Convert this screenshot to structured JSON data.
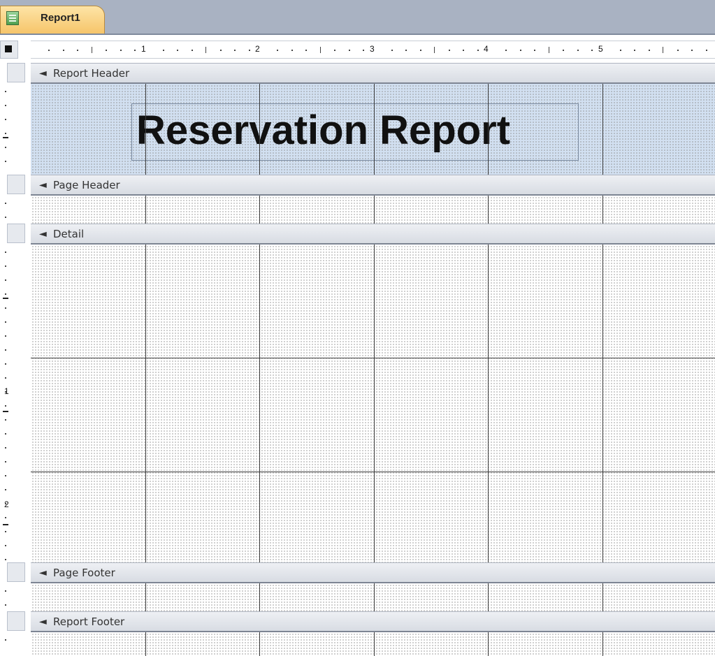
{
  "window": {
    "tab_label": "Report1",
    "tab_icon": "report-icon"
  },
  "ruler": {
    "horizontal_numbers": [
      "1",
      "2",
      "3",
      "4",
      "5"
    ],
    "vertical_numbers": [
      "1",
      "2"
    ]
  },
  "sections": {
    "report_header": {
      "label": "Report Header",
      "icon": "section-collapse-icon"
    },
    "page_header": {
      "label": "Page Header",
      "icon": "section-collapse-icon"
    },
    "detail": {
      "label": "Detail",
      "icon": "section-collapse-icon"
    },
    "page_footer": {
      "label": "Page Footer",
      "icon": "section-collapse-icon"
    },
    "report_footer": {
      "label": "Report Footer",
      "icon": "section-collapse-icon"
    }
  },
  "report_title": "Reservation Report",
  "colors": {
    "selected_section": "#d2e0f1",
    "tab": "#f6c56a",
    "tabbar": "#a9b2c2"
  }
}
